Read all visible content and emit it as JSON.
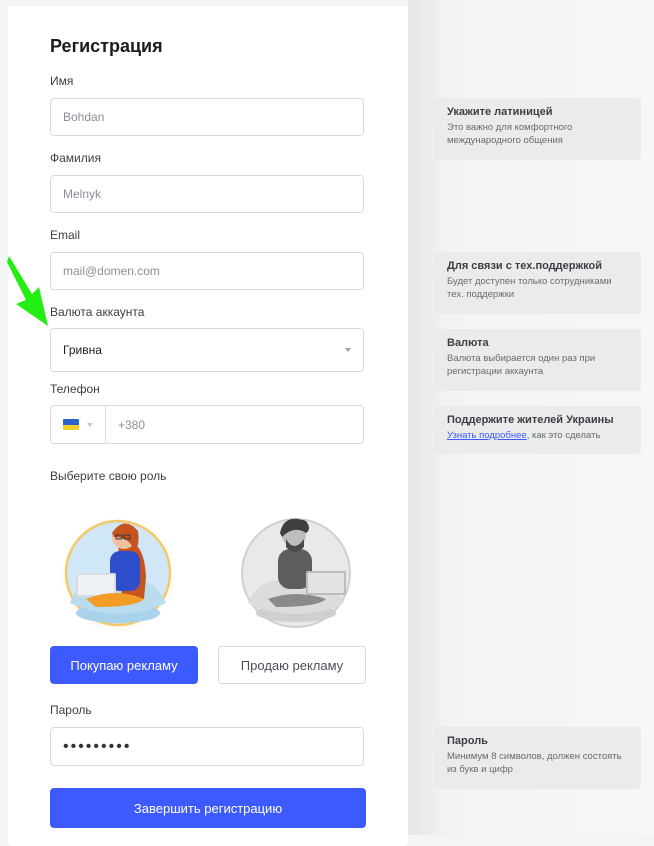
{
  "form": {
    "title": "Регистрация",
    "first_name": {
      "label": "Имя",
      "placeholder": "Bohdan"
    },
    "last_name": {
      "label": "Фамилия",
      "placeholder": "Melnyk"
    },
    "email": {
      "label": "Email",
      "placeholder": "mail@domen.com"
    },
    "currency": {
      "label": "Валюта аккаунта",
      "value": "Гривна"
    },
    "phone": {
      "label": "Телефон",
      "country_flag": "ukraine-flag",
      "placeholder": "+380"
    },
    "role": {
      "label": "Выберите свою роль",
      "buy_label": "Покупаю рекламу",
      "sell_label": "Продаю рекламу",
      "selected": "buy"
    },
    "password": {
      "label": "Пароль",
      "value": "•••••••••"
    },
    "submit_label": "Завершить регистрацию"
  },
  "hints": {
    "name": {
      "title": "Укажите латиницей",
      "text": "Это важно для комфортного международного общения"
    },
    "email": {
      "title": "Для связи с тех.поддержкой",
      "text": "Будет доступен только сотрудниками тех. поддержки"
    },
    "currency": {
      "title": "Валюта",
      "text": "Валюта выбирается один раз при регистрации аккаунта"
    },
    "ukraine": {
      "title": "Поддержите жителей Украины",
      "link": "Узнать подробнее",
      "text": ", как это сделать"
    },
    "password": {
      "title": "Пароль",
      "text": "Минимум 8 символов, должен состоять из букв и цифр"
    }
  },
  "colors": {
    "accent": "#3d5afe",
    "arrow": "#22ee11"
  }
}
